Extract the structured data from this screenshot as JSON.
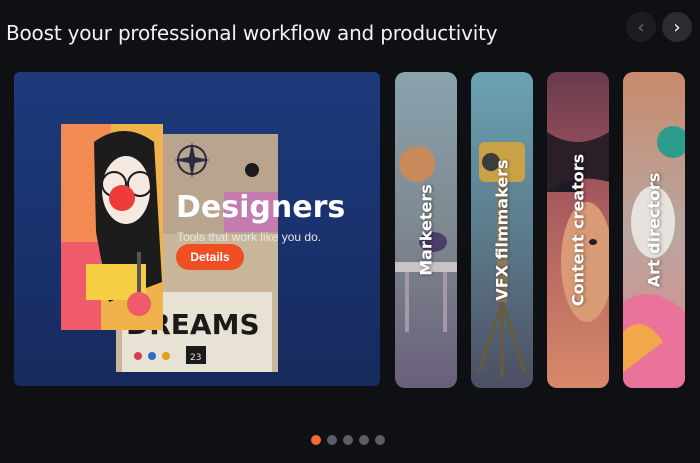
{
  "heading": "Boost your professional workflow and productivity",
  "nav": {
    "prev": "‹",
    "next": "›"
  },
  "featured": {
    "title": "Designers",
    "subtitle": "Tools that work like you do.",
    "button": "Details",
    "poster_word": "DREAMS",
    "poster_number": "23"
  },
  "cards": [
    {
      "label": "Marketers"
    },
    {
      "label": "VFX filmmakers"
    },
    {
      "label": "Content creators"
    },
    {
      "label": "Art directors"
    }
  ],
  "pagination": {
    "count": 5,
    "active_index": 0
  },
  "colors": {
    "accent": "#f04e23",
    "dot_active": "#f26a32",
    "background": "#0f1013"
  }
}
